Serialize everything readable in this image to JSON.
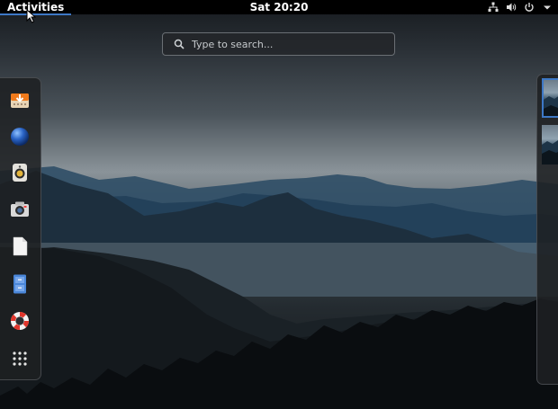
{
  "topbar": {
    "activities_label": "Activities",
    "clock": "Sat 20:20",
    "tray_icons": [
      "network-icon",
      "volume-icon",
      "power-icon",
      "menu-arrow-icon"
    ]
  },
  "search": {
    "placeholder": "Type to search..."
  },
  "dash": {
    "items": [
      {
        "name": "Software Installer",
        "icon": "software-install-icon"
      },
      {
        "name": "Web Browser",
        "icon": "browser-globe-icon"
      },
      {
        "name": "Music Player",
        "icon": "speaker-icon"
      },
      {
        "name": "Camera",
        "icon": "camera-icon"
      },
      {
        "name": "Text Editor",
        "icon": "document-icon"
      },
      {
        "name": "Files",
        "icon": "file-cabinet-icon"
      },
      {
        "name": "Help",
        "icon": "lifebuoy-icon"
      },
      {
        "name": "Show Applications",
        "icon": "app-grid-icon"
      }
    ]
  },
  "workspaces": {
    "count": 2,
    "active_index": 0
  },
  "colors": {
    "topbar_bg": "#000000",
    "accent": "#3d78c6",
    "panel_bg": "#1e2022"
  }
}
